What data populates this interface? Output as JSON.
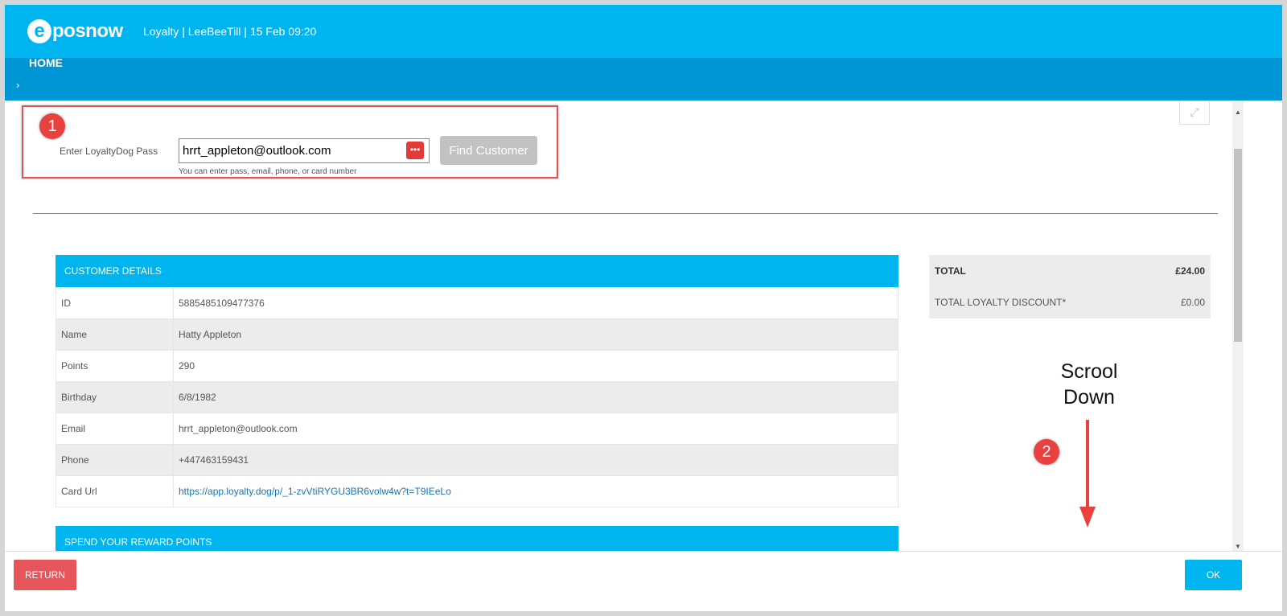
{
  "header": {
    "logo_letter": "e",
    "logo_text": "posnow",
    "info": "Loyalty  |  LeeBeeTill  |  15 Feb 09:20",
    "home_label": "HOME",
    "chevron": "›"
  },
  "search": {
    "badge": "1",
    "label": "Enter LoyaltyDog Pass",
    "value": "hrrt_appleton@outlook.com",
    "hint": "You can enter pass, email, phone, or card number",
    "find_button": "Find Customer"
  },
  "customer": {
    "heading": "CUSTOMER DETAILS",
    "rows": [
      {
        "key": "ID",
        "value": "5885485109477376"
      },
      {
        "key": "Name",
        "value": "Hatty Appleton"
      },
      {
        "key": "Points",
        "value": "290"
      },
      {
        "key": "Birthday",
        "value": "6/8/1982"
      },
      {
        "key": "Email",
        "value": "hrrt_appleton@outlook.com"
      },
      {
        "key": "Phone",
        "value": "+447463159431"
      },
      {
        "key": "Card Url",
        "value": "https://app.loyalty.dog/p/_1-zvVtiRYGU3BR6volw4w?t=T9IEeLo"
      }
    ]
  },
  "reward": {
    "heading": "SPEND YOUR REWARD POINTS"
  },
  "totals": {
    "total_label": "TOTAL",
    "total_value": "£24.00",
    "discount_label": "TOTAL LOYALTY DISCOUNT*",
    "discount_value": "£0.00"
  },
  "annotation": {
    "badge": "2",
    "line1": "Scrool",
    "line2": "Down",
    "color": "#e8413f"
  },
  "footer": {
    "return_label": "RETURN",
    "ok_label": "OK"
  },
  "colors": {
    "brand": "#00b4f0",
    "brand_dark": "#0096d6",
    "danger": "#e5555a"
  }
}
